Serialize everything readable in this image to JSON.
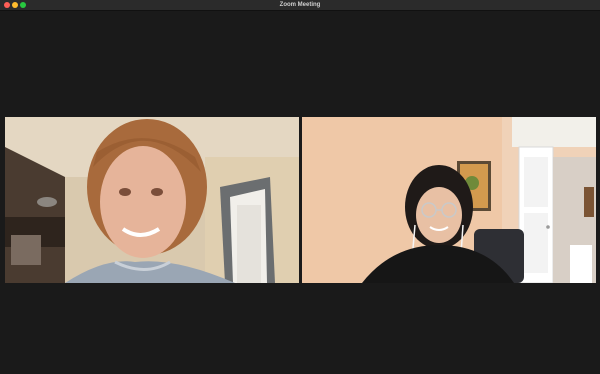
{
  "window": {
    "title": "Zoom Meeting"
  },
  "colors": {
    "background": "#1a1a1a",
    "titlebar": "#2b2b2b",
    "close": "#ff5f57",
    "minimize": "#febc2e",
    "maximize": "#28c840"
  },
  "participants": [
    {
      "video": "participant-video-left"
    },
    {
      "video": "participant-video-right"
    }
  ]
}
